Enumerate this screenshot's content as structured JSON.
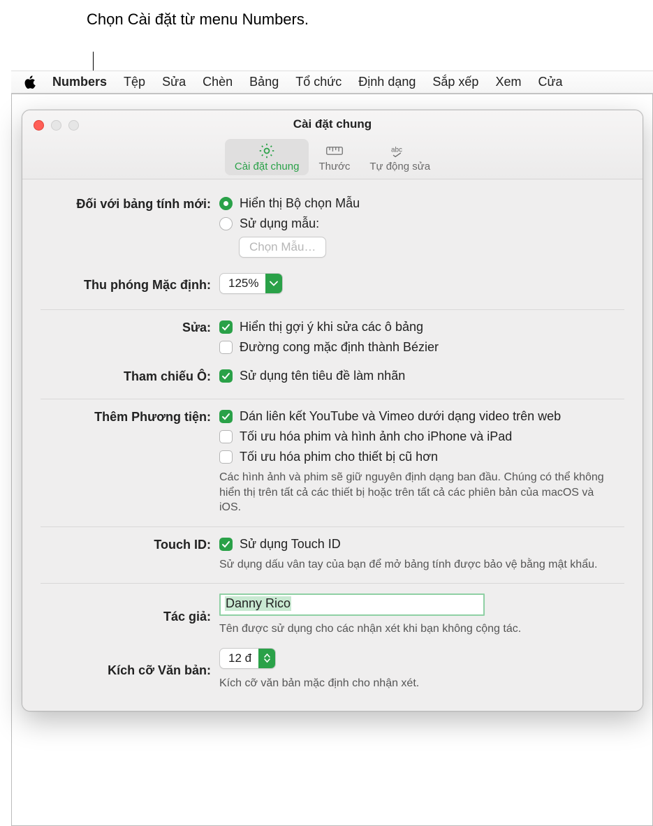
{
  "callout": "Chọn Cài đặt từ menu Numbers.",
  "menubar": {
    "app": "Numbers",
    "items": [
      "Tệp",
      "Sửa",
      "Chèn",
      "Bảng",
      "Tổ chức",
      "Định dạng",
      "Sắp xếp",
      "Xem",
      "Cửa"
    ]
  },
  "window": {
    "title": "Cài đặt chung",
    "tabs": [
      {
        "label": "Cài đặt chung",
        "icon": "gear-icon",
        "active": true
      },
      {
        "label": "Thước",
        "icon": "ruler-icon",
        "active": false
      },
      {
        "label": "Tự động sửa",
        "icon": "abc-icon",
        "active": false
      }
    ]
  },
  "general": {
    "new_spreadsheet_label": "Đối với bảng tính mới:",
    "radio_template_chooser": "Hiển thị Bộ chọn Mẫu",
    "radio_use_template": "Sử dụng mẫu:",
    "choose_template_btn": "Chọn Mẫu…",
    "zoom_label": "Thu phóng Mặc định:",
    "zoom_value": "125%"
  },
  "edit": {
    "label": "Sửa:",
    "suggestions": "Hiển thị gợi ý khi sửa các ô bảng",
    "bezier": "Đường cong mặc định thành Bézier"
  },
  "cellref": {
    "label": "Tham chiếu Ô:",
    "useheader": "Sử dụng tên tiêu đề làm nhãn"
  },
  "media": {
    "label": "Thêm Phương tiện:",
    "paste_links": "Dán liên kết YouTube và Vimeo dưới dạng video trên web",
    "optimize_ios": "Tối ưu hóa phim và hình ảnh cho iPhone và iPad",
    "optimize_old": "Tối ưu hóa phim cho thiết bị cũ hơn",
    "hint": "Các hình ảnh và phim sẽ giữ nguyên định dạng ban đầu. Chúng có thể không hiển thị trên tất cả các thiết bị hoặc trên tất cả các phiên bản của macOS và iOS."
  },
  "touchid": {
    "label": "Touch ID:",
    "use": "Sử dụng Touch ID",
    "hint": "Sử dụng dấu vân tay của bạn để mở bảng tính được bảo vệ bằng mật khẩu."
  },
  "author": {
    "label": "Tác giả:",
    "value": "Danny Rico",
    "hint": "Tên được sử dụng cho các nhận xét khi bạn không cộng tác."
  },
  "textsize": {
    "label": "Kích cỡ Văn bản:",
    "value": "12 đ",
    "hint": "Kích cỡ văn bản mặc định cho nhận xét."
  }
}
